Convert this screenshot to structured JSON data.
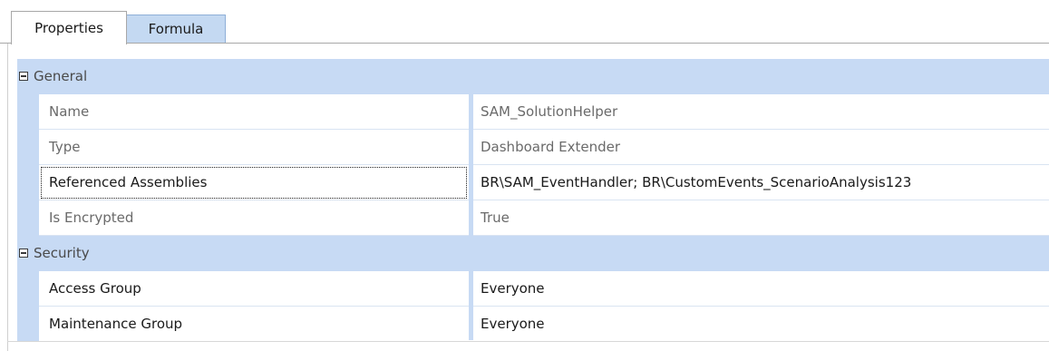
{
  "tabs": [
    {
      "label": "Properties",
      "active": true
    },
    {
      "label": "Formula",
      "active": false
    }
  ],
  "categories": {
    "general": {
      "label": "General",
      "rows": [
        {
          "name": "Name",
          "value": "SAM_SolutionHelper",
          "readonly": true
        },
        {
          "name": "Type",
          "value": "Dashboard Extender",
          "readonly": true
        },
        {
          "name": "Referenced Assemblies",
          "value": "BR\\SAM_EventHandler; BR\\CustomEvents_ScenarioAnalysis123",
          "readonly": false,
          "selected": true
        },
        {
          "name": "Is Encrypted",
          "value": "True",
          "readonly": true
        }
      ]
    },
    "security": {
      "label": "Security",
      "rows": [
        {
          "name": "Access Group",
          "value": "Everyone",
          "readonly": false
        },
        {
          "name": "Maintenance Group",
          "value": "Everyone",
          "readonly": false
        }
      ]
    }
  },
  "colors": {
    "category_bg": "#c7daf4",
    "inactive_tab_bg": "#c4d9f2",
    "readonly_text": "#6a6a6a"
  },
  "icons": {
    "collapse": "minus-box-icon"
  }
}
